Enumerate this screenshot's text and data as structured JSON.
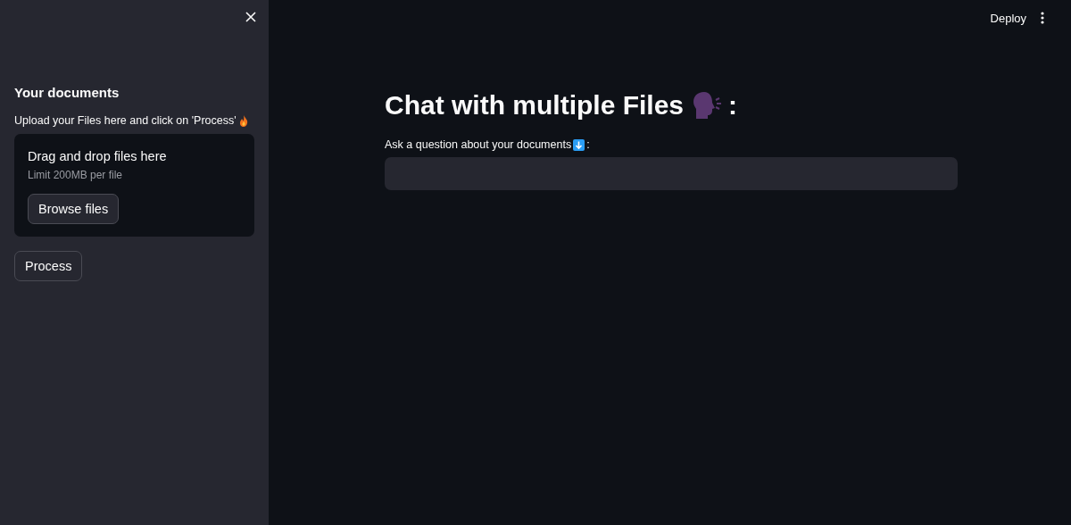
{
  "sidebar": {
    "heading": "Your documents",
    "caption": "Upload your Files here and click on 'Process'",
    "uploader": {
      "title": "Drag and drop files here",
      "limit": "Limit 200MB per file",
      "button": "Browse files"
    },
    "button": "Process"
  },
  "header": {
    "deploy": "Deploy"
  },
  "main": {
    "title": "Chat with multiple Files",
    "title_suffix": ":",
    "question": {
      "label": "Ask a question about your documents",
      "label_suffix": ":"
    }
  }
}
